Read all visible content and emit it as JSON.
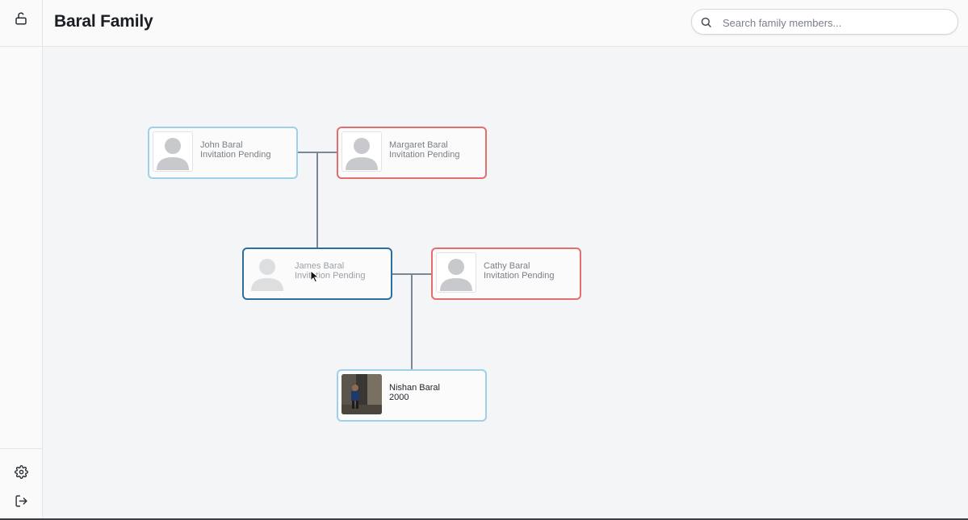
{
  "header": {
    "title": "Baral Family",
    "search_placeholder": "Search family members..."
  },
  "sidebar": {
    "top_icon": "unlock-icon",
    "bottom_icons": [
      "gear-icon",
      "logout-icon"
    ]
  },
  "members": {
    "john": {
      "name": "John Baral",
      "status": "Invitation Pending",
      "gender": "male"
    },
    "margaret": {
      "name": "Margaret Baral",
      "status": "Invitation Pending",
      "gender": "female"
    },
    "james": {
      "name": "James Baral",
      "status": "Invitation Pending",
      "gender": "male",
      "selected": true
    },
    "cathy": {
      "name": "Cathy Baral",
      "status": "Invitation Pending",
      "gender": "female"
    },
    "nishan": {
      "name": "Nishan Baral",
      "status": "2000",
      "gender": "male",
      "has_photo": true
    }
  },
  "colors": {
    "male_border": "#9fd0ea",
    "female_border": "#e46d6d",
    "selected_border": "#2c6e9e",
    "connector": "#7b8794"
  }
}
